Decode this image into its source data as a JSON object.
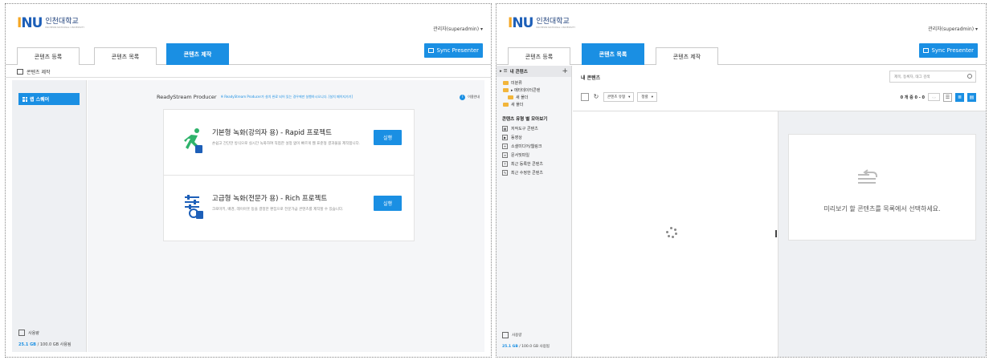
{
  "brand": {
    "logo_mark_i": "I",
    "logo_mark_n": "N",
    "logo_mark_u": "U",
    "name": "인천대학교",
    "subtitle": "INCHEON NATIONAL UNIVERSITY"
  },
  "user": {
    "label": "관리자(superadmin)",
    "caret": "▾"
  },
  "left": {
    "tabs": [
      {
        "label": "콘텐츠 등록",
        "active": false
      },
      {
        "label": "콘텐츠 목록",
        "active": false
      },
      {
        "label": "콘텐츠 제작",
        "active": true
      }
    ],
    "sync_label": "Sync Presenter",
    "page_title": "콘텐츠 제작",
    "side_button": "랩 스퀘어",
    "storage": {
      "label": "사용량",
      "used": "25.1 GB",
      "total": " / 100.0 GB 사용됨"
    },
    "producer": {
      "title": "ReadyStream Producer",
      "note": "※ ReadyStream Producer가 설치 완료 되어 있는 경우에만 실행하시오니다. [설치 페이지가기]",
      "help": "이용안내",
      "help_icon": "i"
    },
    "cards": [
      {
        "title": "기본형 녹화(강의자 용) - Rapid 프로젝트",
        "desc": "손쉽고 간단한 방식으로 실시간 녹화하여 직접한 설정 없이 빠르게 웹 표준형 결과물을 제작합니다.",
        "button": "실행"
      },
      {
        "title": "고급형 녹화(전문가 용) - Rich 프로젝트",
        "desc": "크로마키, 배경, 레이아웃 등을 결정한 편집으로 전문가급 콘텐츠를 제작할 수 있습니다.",
        "button": "실행"
      }
    ]
  },
  "right": {
    "tabs": [
      {
        "label": "콘텐츠 등록",
        "active": false
      },
      {
        "label": "콘텐츠 목록",
        "active": true
      },
      {
        "label": "콘텐츠 제작",
        "active": false
      }
    ],
    "sync_label": "Sync Presenter",
    "tree": {
      "head": "내 콘텐츠",
      "head_marker": "▸ ☰",
      "add": "+",
      "items": [
        {
          "label": "미분류",
          "sub": false
        },
        {
          "label": "▸ 메타데이터콘텐",
          "sub": false
        },
        {
          "label": "새 폴더",
          "sub": true
        },
        {
          "label": "새 폴더",
          "sub": false
        }
      ]
    },
    "types": {
      "title": "콘텐츠 유형 별 모아보기",
      "items": [
        {
          "label": "저작도구 콘텐츠",
          "icon": "▦"
        },
        {
          "label": "동영상",
          "icon": "▶"
        },
        {
          "label": "소셜미디어/웹링크",
          "icon": "⚭"
        },
        {
          "label": "문서및파일",
          "icon": "≡"
        },
        {
          "label": "최근 등록한 콘텐츠",
          "icon": "↑"
        },
        {
          "label": "최근 수정한 콘텐츠",
          "icon": "✎"
        }
      ]
    },
    "storage": {
      "label": "사용량",
      "used": "25.1 GB",
      "total": " / 100.0 GB 사용됨"
    },
    "main_title": "내 콘텐츠",
    "search_placeholder": "제목, 등록자, 태그 검색",
    "refresh": "↻",
    "filter1": "콘텐츠 유형",
    "filter2": "정렬",
    "dropdown_caret": "▾",
    "count": "0 개 중 0 - 0",
    "pager_prev": "‹",
    "pager_next": "›",
    "view_icons": [
      "☰",
      "≣",
      "▤"
    ],
    "preview_text": "미리보기 할 콘텐츠를 목록에서 선택하세요."
  }
}
